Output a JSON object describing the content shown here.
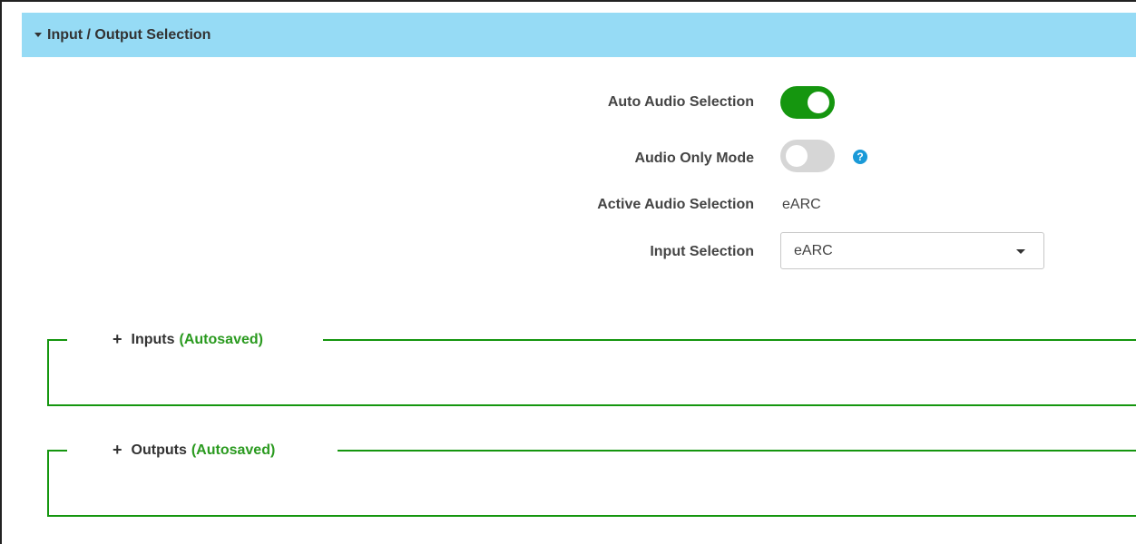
{
  "panel": {
    "title": "Input / Output Selection"
  },
  "form": {
    "auto_audio_label": "Auto Audio Selection",
    "auto_audio_on": true,
    "audio_only_label": "Audio Only Mode",
    "audio_only_on": false,
    "help_glyph": "?",
    "active_audio_label": "Active Audio Selection",
    "active_audio_value": "eARC",
    "input_selection_label": "Input Selection",
    "input_selection_value": "eARC"
  },
  "sections": {
    "inputs": {
      "expand_glyph": "+",
      "label": "Inputs",
      "status": "(Autosaved)"
    },
    "outputs": {
      "expand_glyph": "+",
      "label": "Outputs",
      "status": "(Autosaved)"
    }
  },
  "colors": {
    "header_bg": "#96dbf5",
    "toggle_on": "#15960f",
    "toggle_off": "#d6d6d6",
    "section_border": "#15960f",
    "autosaved_text": "#2a9a1f",
    "help_icon": "#1a9ad8"
  },
  "icons": {
    "header_caret": "caret-down-icon",
    "help": "question-circle-icon",
    "select_caret": "caret-down-icon",
    "expand": "plus-icon"
  }
}
